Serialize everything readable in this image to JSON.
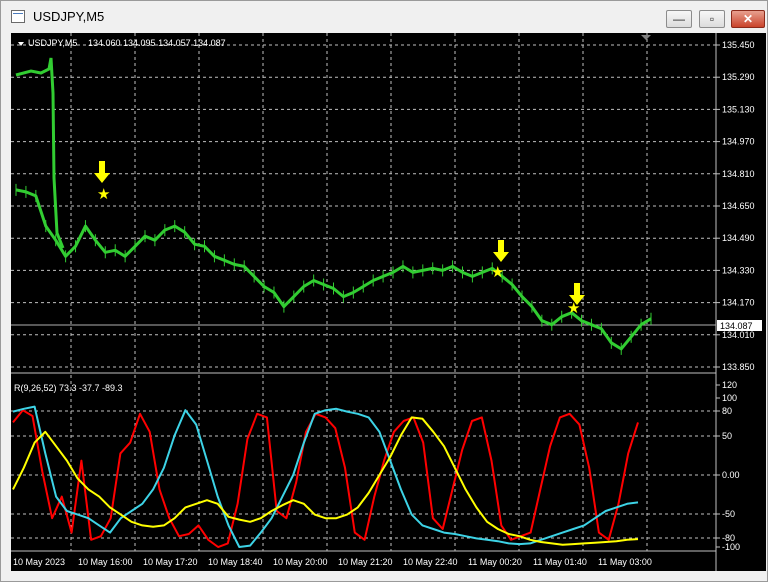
{
  "window": {
    "title": "USDJPY,M5",
    "buttons": {
      "minimize": "—",
      "maximize": "▫",
      "close": "✕"
    }
  },
  "symbol_info": {
    "label": "USDJPY,M5",
    "ohlc": "134.060 134.095 134.057 134.087"
  },
  "price_axis": {
    "ticks": [
      "135.450",
      "135.290",
      "135.130",
      "134.970",
      "134.810",
      "134.650",
      "134.490",
      "134.330",
      "134.170",
      "134.010",
      "133.850"
    ],
    "current": "134.087"
  },
  "indicator": {
    "label": "R(9,26,52) 73.3 -37.7 -89.3",
    "ticks": [
      "120",
      "100",
      "80",
      "50",
      "0.00",
      "-50",
      "-80",
      "-100"
    ]
  },
  "time_axis": {
    "labels": [
      "10 May 2023",
      "10 May 16:00",
      "10 May 17:20",
      "10 May 18:40",
      "10 May 20:00",
      "10 May 21:20",
      "10 May 22:40",
      "11 May 00:20",
      "11 May 01:40",
      "11 May 03:00"
    ]
  },
  "colors": {
    "background": "#000000",
    "price": "#32cd32",
    "grid": "#c0c0c0",
    "marker": "#ffff00",
    "line_red": "#ff0000",
    "line_cyan": "#3dd3e6",
    "line_yellow": "#ffff00"
  },
  "chart_data": {
    "type": "line",
    "series": [
      {
        "values": [
          134.73,
          134.72,
          134.7,
          134.55,
          134.48,
          134.4,
          134.45,
          134.55,
          134.48,
          134.42,
          134.43,
          134.4,
          134.45,
          134.5,
          134.48,
          134.53,
          134.55,
          134.52,
          134.46,
          134.45,
          134.4,
          134.38,
          134.36,
          134.35,
          134.3,
          134.25,
          134.22,
          134.15,
          134.2,
          134.25,
          134.28,
          134.26,
          134.24,
          134.2,
          134.22,
          134.25,
          134.28,
          134.3,
          134.32,
          134.35,
          134.32,
          134.33,
          134.34,
          134.33,
          134.35,
          134.32,
          134.3,
          134.32,
          134.34,
          134.3,
          134.26,
          134.2,
          134.15,
          134.08,
          134.06,
          134.1,
          134.12,
          134.08,
          134.06,
          134.04,
          133.97,
          133.94,
          134.0,
          134.06,
          134.09
        ]
      },
      {
        "values": [
          73,
          90,
          82,
          5,
          -60,
          -30,
          -80,
          20,
          -90,
          -85,
          -60,
          30,
          45,
          85,
          60,
          -20,
          -60,
          -85,
          -82,
          -70,
          -90,
          -100,
          -95,
          -40,
          50,
          85,
          80,
          -50,
          -60,
          -10,
          60,
          85,
          80,
          65,
          10,
          -80,
          -90,
          -30,
          20,
          60,
          75,
          80,
          45,
          -60,
          -75,
          -20,
          35,
          75,
          80,
          20,
          -70,
          -90,
          -85,
          -80,
          -20,
          40,
          80,
          85,
          70,
          10,
          -80,
          -90,
          -40,
          30,
          73
        ]
      },
      {
        "values": [
          88,
          92,
          95,
          30,
          -30,
          -50,
          -55,
          -60,
          -70,
          -80,
          -60,
          -50,
          -40,
          -20,
          10,
          55,
          90,
          70,
          20,
          -30,
          -70,
          -100,
          -98,
          -80,
          -60,
          -30,
          0,
          45,
          85,
          90,
          92,
          88,
          85,
          80,
          60,
          20,
          -20,
          -55,
          -70,
          -75,
          -80,
          -82,
          -85,
          -88,
          -90,
          -92,
          -95,
          -96,
          -95,
          -90,
          -85,
          -80,
          -75,
          -70,
          -60,
          -50,
          -45,
          -40,
          -38
        ]
      },
      {
        "values": [
          -20,
          10,
          45,
          60,
          40,
          20,
          -5,
          -20,
          -30,
          -45,
          -55,
          -65,
          -70,
          -72,
          -70,
          -60,
          -45,
          -40,
          -35,
          -40,
          -58,
          -62,
          -65,
          -60,
          -50,
          -42,
          -35,
          -40,
          -55,
          -60,
          -60,
          -55,
          -45,
          -25,
          0,
          25,
          55,
          80,
          78,
          60,
          40,
          10,
          -20,
          -45,
          -65,
          -75,
          -82,
          -85,
          -90,
          -93,
          -95,
          -97,
          -96,
          -95,
          -94,
          -93,
          -92,
          -90,
          -89
        ]
      }
    ]
  }
}
